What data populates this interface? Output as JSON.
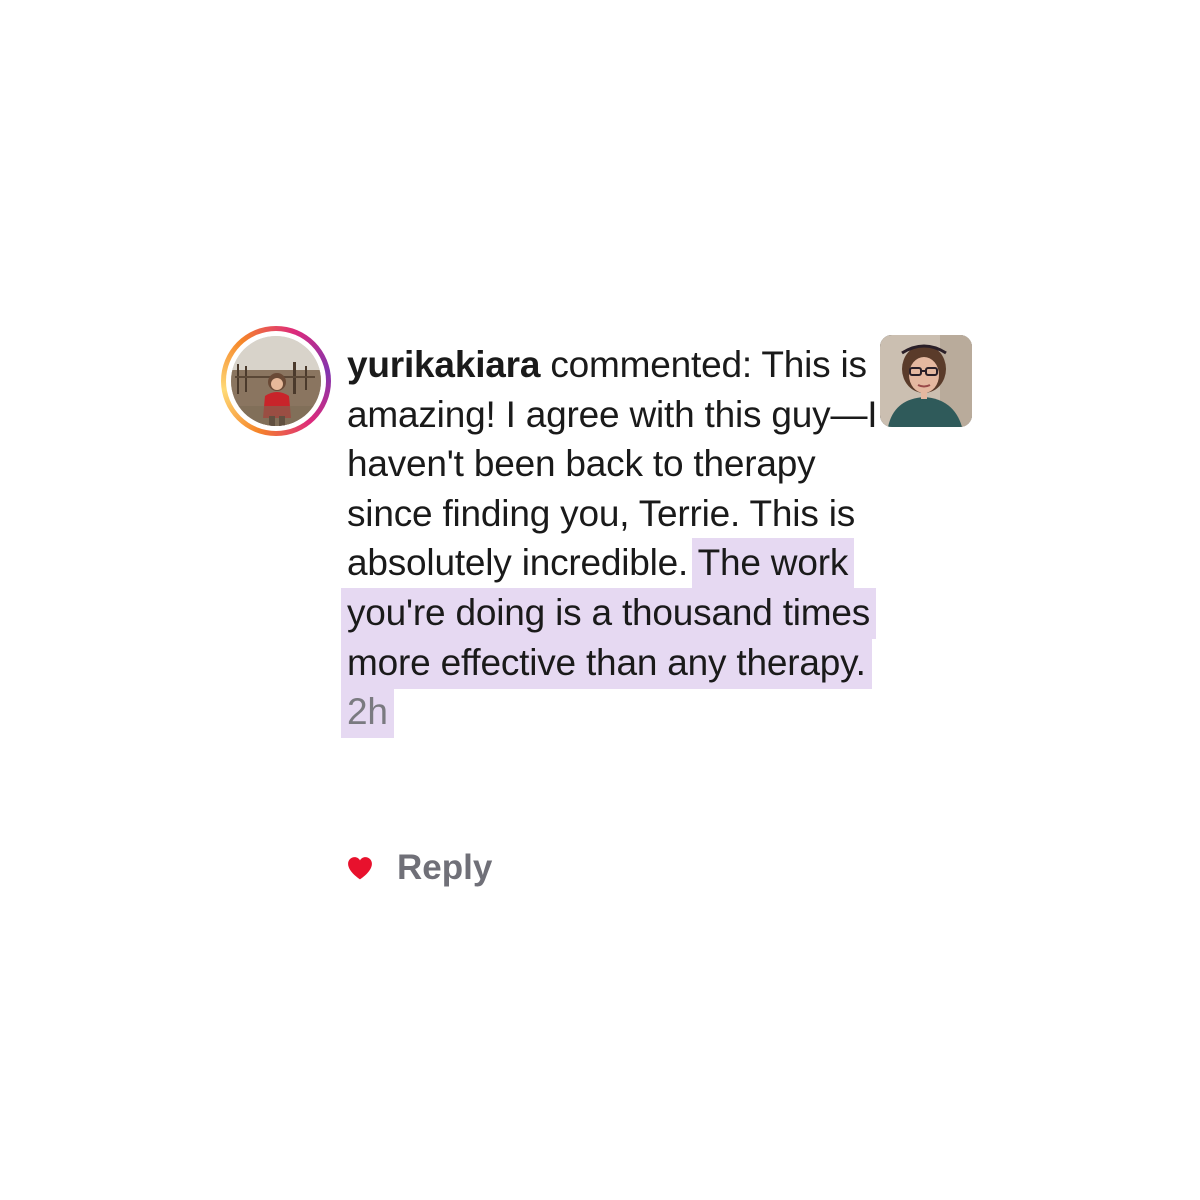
{
  "comment": {
    "username": "yurikakiara",
    "verb": "commented:",
    "text_plain": "This is amazing! I agree with this guy—I haven't been back to therapy since finding you, Terrie. This is absolutely incredible.",
    "text_highlighted": "The work you're doing is a thousand times more effective than any therapy.",
    "timestamp": "2h",
    "liked": true,
    "reply_label": "Reply"
  },
  "colors": {
    "highlight": "#e6d9f2",
    "heart": "#e8112d",
    "text": "#1a1a1a",
    "muted": "#707078"
  },
  "icons": {
    "heart": "heart-icon",
    "avatar": "avatar",
    "thumbnail": "video-thumbnail"
  }
}
